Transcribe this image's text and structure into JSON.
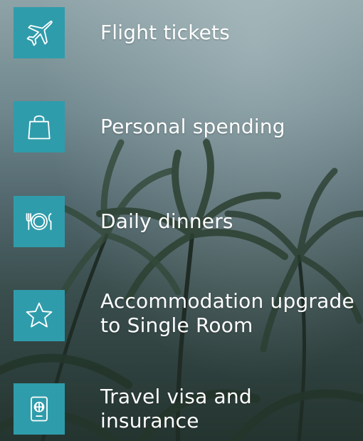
{
  "items": [
    {
      "icon": "airplane-icon",
      "label": "Flight tickets"
    },
    {
      "icon": "shopping-bag-icon",
      "label": "Personal spending"
    },
    {
      "icon": "plate-cutlery-icon",
      "label": "Daily dinners"
    },
    {
      "icon": "star-icon",
      "label": "Accommodation upgrade\nto Single Room"
    },
    {
      "icon": "passport-icon",
      "label": "Travel visa and insurance"
    }
  ],
  "colors": {
    "icon_bg": "#2f9cab",
    "text": "#ffffff"
  }
}
